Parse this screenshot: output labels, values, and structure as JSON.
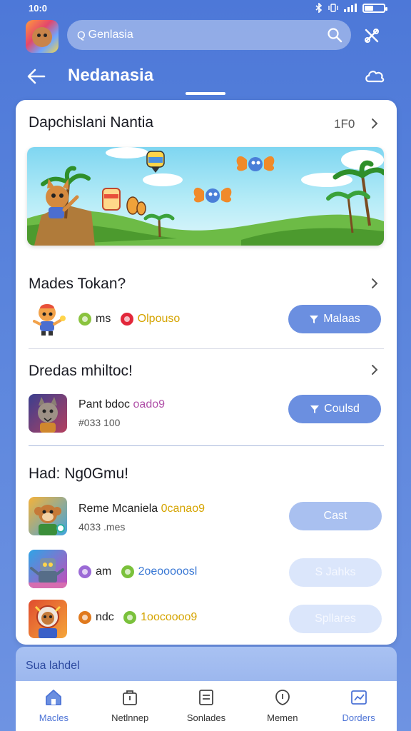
{
  "status_bar": {
    "time": "10:0"
  },
  "search": {
    "prefix": "Q",
    "placeholder": "Genlasia"
  },
  "header": {
    "title": "Nedanasia"
  },
  "card": {
    "section1": {
      "title": "Dapchislani Nantia",
      "count": "1F0"
    },
    "section2": {
      "title": "Mades Tokan?",
      "row": {
        "name": "ms",
        "tag": "Olpouso",
        "button": "Malaas"
      }
    },
    "section3": {
      "title": "Dredas mhiltoc!",
      "row": {
        "name": "Pant bdoc",
        "tag": "oado9",
        "sub": "#033 100",
        "button": "Coulsd"
      }
    },
    "section4": {
      "title": "Had: Ng0Gmu!",
      "rows": [
        {
          "name": "Reme Mcaniela",
          "tag": "0canao9",
          "sub": "4033 .mes",
          "button": "Cast"
        },
        {
          "name": "am",
          "tag": "2oeooooosl",
          "button": "S Jahks"
        },
        {
          "name": "ndc",
          "tag": "1oocoooo9",
          "button": "Spllares"
        }
      ]
    }
  },
  "promo": {
    "label": "Sua lahdel"
  },
  "nav": {
    "items": [
      {
        "label": "Macles",
        "icon": "home-icon"
      },
      {
        "label": "Netlnnep",
        "icon": "bag-icon"
      },
      {
        "label": "Sonlades",
        "icon": "document-icon"
      },
      {
        "label": "Memen",
        "icon": "shield-icon"
      },
      {
        "label": "Dorders",
        "icon": "chart-icon"
      }
    ],
    "active_index": 0
  },
  "colors": {
    "accent": "#4c73d6",
    "button": "#6b8fe0",
    "background": "#5a84dc"
  }
}
